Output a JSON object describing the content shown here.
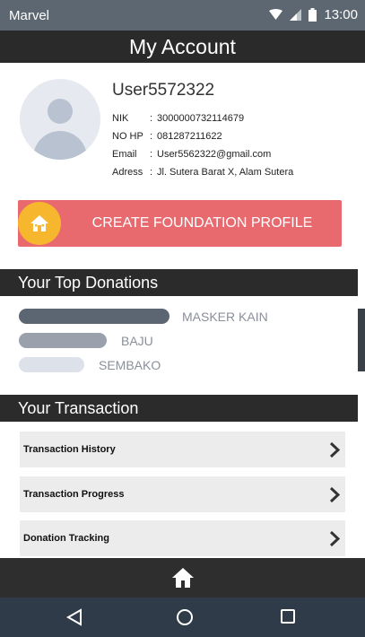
{
  "status": {
    "carrier": "Marvel",
    "time": "13:00"
  },
  "header": {
    "title": "My Account"
  },
  "profile": {
    "username": "User5572322",
    "info": [
      {
        "key": "NIK",
        "value": "3000000732114679"
      },
      {
        "key": "NO HP",
        "value": "081287211622"
      },
      {
        "key": "Email",
        "value": "User5562322@gmail.com"
      },
      {
        "key": "Adress",
        "value": "Jl. Sutera Barat X, Alam Sutera"
      }
    ],
    "create_button_label": "CREATE FOUNDATION PROFILE"
  },
  "donations": {
    "title": "Your Top Donations",
    "items": [
      {
        "label": "MASKER KAIN",
        "color": "#5c6672"
      },
      {
        "label": "BAJU",
        "color": "#9aa1ac"
      },
      {
        "label": "SEMBAKO",
        "color": "#dde2ea"
      }
    ]
  },
  "transaction": {
    "title": "Your Transaction",
    "items": [
      {
        "label": "Transaction History"
      },
      {
        "label": "Transaction Progress"
      },
      {
        "label": "Donation Tracking"
      }
    ]
  },
  "colors": {
    "accent": "#e86a6f",
    "badge": "#f6b62e"
  }
}
